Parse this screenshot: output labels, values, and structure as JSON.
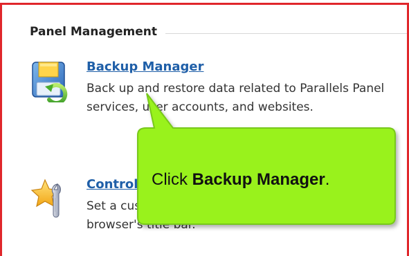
{
  "section": {
    "title": "Panel Management"
  },
  "items": [
    {
      "title": "Backup Manager",
      "description": "Back up and restore data related to Parallels Panel services, user accounts, and websites.",
      "icon": "backup-floppy-icon"
    },
    {
      "title": "Control Panel Branding",
      "description": "Set a custom title and logo to be shown in the browser's title bar.",
      "icon": "customize-star-wrench-icon"
    }
  ],
  "callout": {
    "prefix": "Click ",
    "target": "Backup Manager",
    "suffix": ".",
    "fill_color": "#99f21a",
    "border_color": "#78c81a"
  },
  "frame": {
    "border_color": "#e0262b"
  }
}
